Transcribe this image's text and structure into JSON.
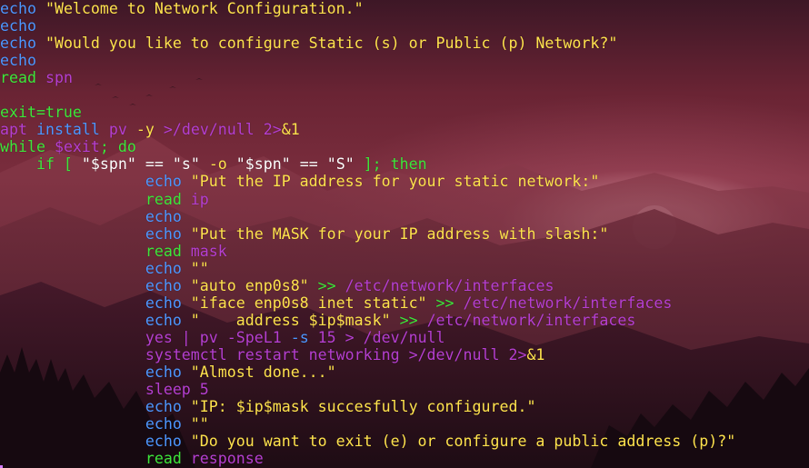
{
  "terminal": {
    "lines": [
      [
        {
          "t": "echo",
          "c": "kw"
        },
        {
          "t": " \"Welcome to Network Configuration.\"",
          "c": "str"
        }
      ],
      [
        {
          "t": "echo",
          "c": "kw"
        }
      ],
      [
        {
          "t": "echo",
          "c": "kw"
        },
        {
          "t": " \"Would you like to configure Static (s) or Public (p) Network?\"",
          "c": "str"
        }
      ],
      [
        {
          "t": "echo",
          "c": "kw"
        }
      ],
      [
        {
          "t": "read",
          "c": "grn"
        },
        {
          "t": " spn",
          "c": "pur"
        }
      ],
      [
        {
          "t": "",
          "c": "sym"
        }
      ],
      [
        {
          "t": "exit=true",
          "c": "grn"
        }
      ],
      [
        {
          "t": "apt ",
          "c": "pur"
        },
        {
          "t": "install",
          "c": "kw"
        },
        {
          "t": " pv ",
          "c": "pur"
        },
        {
          "t": "-y",
          "c": "str"
        },
        {
          "t": " ",
          "c": "sym"
        },
        {
          "t": ">/dev/null 2>",
          "c": "pur"
        },
        {
          "t": "&1",
          "c": "str"
        }
      ],
      [
        {
          "t": "while ",
          "c": "grn"
        },
        {
          "t": "$exit",
          "c": "pur"
        },
        {
          "t": "; do",
          "c": "grn"
        }
      ],
      [
        {
          "t": "    if [ ",
          "c": "grn"
        },
        {
          "t": "\"$spn\"",
          "c": "sym"
        },
        {
          "t": " == ",
          "c": "sym"
        },
        {
          "t": "\"s\"",
          "c": "sym"
        },
        {
          "t": " -o ",
          "c": "str"
        },
        {
          "t": "\"$spn\"",
          "c": "sym"
        },
        {
          "t": " == ",
          "c": "sym"
        },
        {
          "t": "\"S\"",
          "c": "sym"
        },
        {
          "t": " ]; then",
          "c": "grn"
        }
      ],
      [
        {
          "t": "                echo",
          "c": "kw"
        },
        {
          "t": " \"Put the IP address for your static network:\"",
          "c": "str"
        }
      ],
      [
        {
          "t": "                read",
          "c": "grn"
        },
        {
          "t": " ip",
          "c": "pur"
        }
      ],
      [
        {
          "t": "                echo",
          "c": "kw"
        }
      ],
      [
        {
          "t": "                echo",
          "c": "kw"
        },
        {
          "t": " \"Put the MASK for your IP address with slash:\"",
          "c": "str"
        }
      ],
      [
        {
          "t": "                read",
          "c": "grn"
        },
        {
          "t": " mask",
          "c": "pur"
        }
      ],
      [
        {
          "t": "                echo",
          "c": "kw"
        },
        {
          "t": " \"\"",
          "c": "str"
        }
      ],
      [
        {
          "t": "                echo",
          "c": "kw"
        },
        {
          "t": " \"auto enp0s8\"",
          "c": "str"
        },
        {
          "t": " >> ",
          "c": "grn"
        },
        {
          "t": "/etc/network/interfaces",
          "c": "pur"
        }
      ],
      [
        {
          "t": "                echo",
          "c": "kw"
        },
        {
          "t": " \"iface enp0s8 inet static\"",
          "c": "str"
        },
        {
          "t": " >> ",
          "c": "grn"
        },
        {
          "t": "/etc/network/interfaces",
          "c": "pur"
        }
      ],
      [
        {
          "t": "                echo",
          "c": "kw"
        },
        {
          "t": " \"    address $ip$mask\"",
          "c": "str"
        },
        {
          "t": " >> ",
          "c": "grn"
        },
        {
          "t": "/etc/network/interfaces",
          "c": "pur"
        }
      ],
      [
        {
          "t": "                yes | pv -SpeL1 ",
          "c": "pur"
        },
        {
          "t": "-s",
          "c": "kw"
        },
        {
          "t": " 15 > /dev/null",
          "c": "pur"
        }
      ],
      [
        {
          "t": "                systemctl restart networking >/dev/null 2>",
          "c": "pur"
        },
        {
          "t": "&1",
          "c": "str"
        }
      ],
      [
        {
          "t": "                echo",
          "c": "kw"
        },
        {
          "t": " \"Almost done...\"",
          "c": "str"
        }
      ],
      [
        {
          "t": "                sleep 5",
          "c": "pur"
        }
      ],
      [
        {
          "t": "                echo",
          "c": "kw"
        },
        {
          "t": " \"IP: $ip$mask succesfully configured.\"",
          "c": "str"
        }
      ],
      [
        {
          "t": "                echo",
          "c": "kw"
        },
        {
          "t": " \"\"",
          "c": "str"
        }
      ],
      [
        {
          "t": "                echo",
          "c": "kw"
        },
        {
          "t": " \"Do you want to exit (e) or configure a public address (p)?\"",
          "c": "str"
        }
      ],
      [
        {
          "t": "                read",
          "c": "grn"
        },
        {
          "t": " response",
          "c": "pur"
        }
      ]
    ]
  }
}
